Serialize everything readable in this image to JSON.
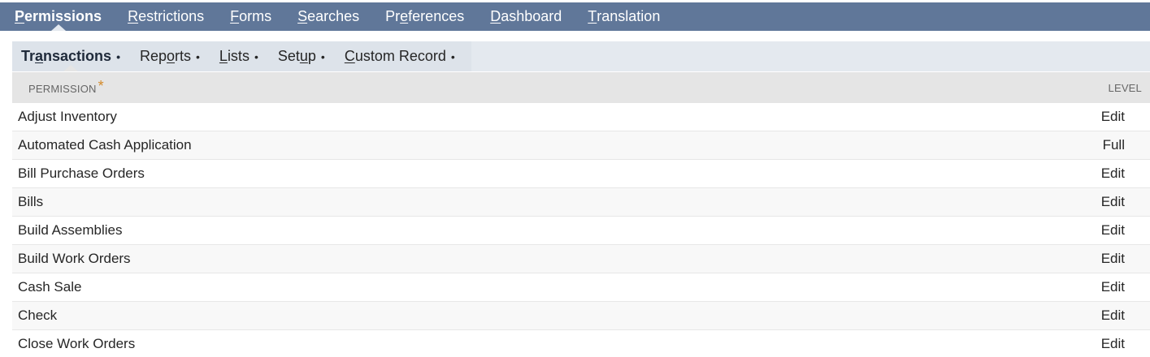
{
  "top_tabs": [
    {
      "pre": "",
      "ul": "P",
      "post": "ermissions"
    },
    {
      "pre": "",
      "ul": "R",
      "post": "estrictions"
    },
    {
      "pre": "",
      "ul": "F",
      "post": "orms"
    },
    {
      "pre": "",
      "ul": "S",
      "post": "earches"
    },
    {
      "pre": "Pr",
      "ul": "e",
      "post": "ferences"
    },
    {
      "pre": "",
      "ul": "D",
      "post": "ashboard"
    },
    {
      "pre": "",
      "ul": "T",
      "post": "ranslation"
    }
  ],
  "sub_tabs": [
    {
      "pre": "Tr",
      "ul": "a",
      "post": "nsactions",
      "dot": "•"
    },
    {
      "pre": "Rep",
      "ul": "o",
      "post": "rts",
      "dot": "•"
    },
    {
      "pre": "",
      "ul": "L",
      "post": "ists",
      "dot": "•"
    },
    {
      "pre": "Set",
      "ul": "u",
      "post": "p",
      "dot": "•"
    },
    {
      "pre": "",
      "ul": "C",
      "post": "ustom Record",
      "dot": "•"
    }
  ],
  "table": {
    "header_permission": "PERMISSION",
    "required_marker": "*",
    "header_level": "LEVEL",
    "rows": [
      {
        "permission": "Adjust Inventory",
        "level": "Edit"
      },
      {
        "permission": "Automated Cash Application",
        "level": "Full"
      },
      {
        "permission": "Bill Purchase Orders",
        "level": "Edit"
      },
      {
        "permission": "Bills",
        "level": "Edit"
      },
      {
        "permission": "Build Assemblies",
        "level": "Edit"
      },
      {
        "permission": "Build Work Orders",
        "level": "Edit"
      },
      {
        "permission": "Cash Sale",
        "level": "Edit"
      },
      {
        "permission": "Check",
        "level": "Edit"
      },
      {
        "permission": "Close Work Orders",
        "level": "Edit"
      }
    ]
  },
  "colors": {
    "top_bar": "#607799",
    "sub_bar": "#e4e9ef",
    "header_bg": "#e5e5e5",
    "required": "#d48a2a"
  }
}
